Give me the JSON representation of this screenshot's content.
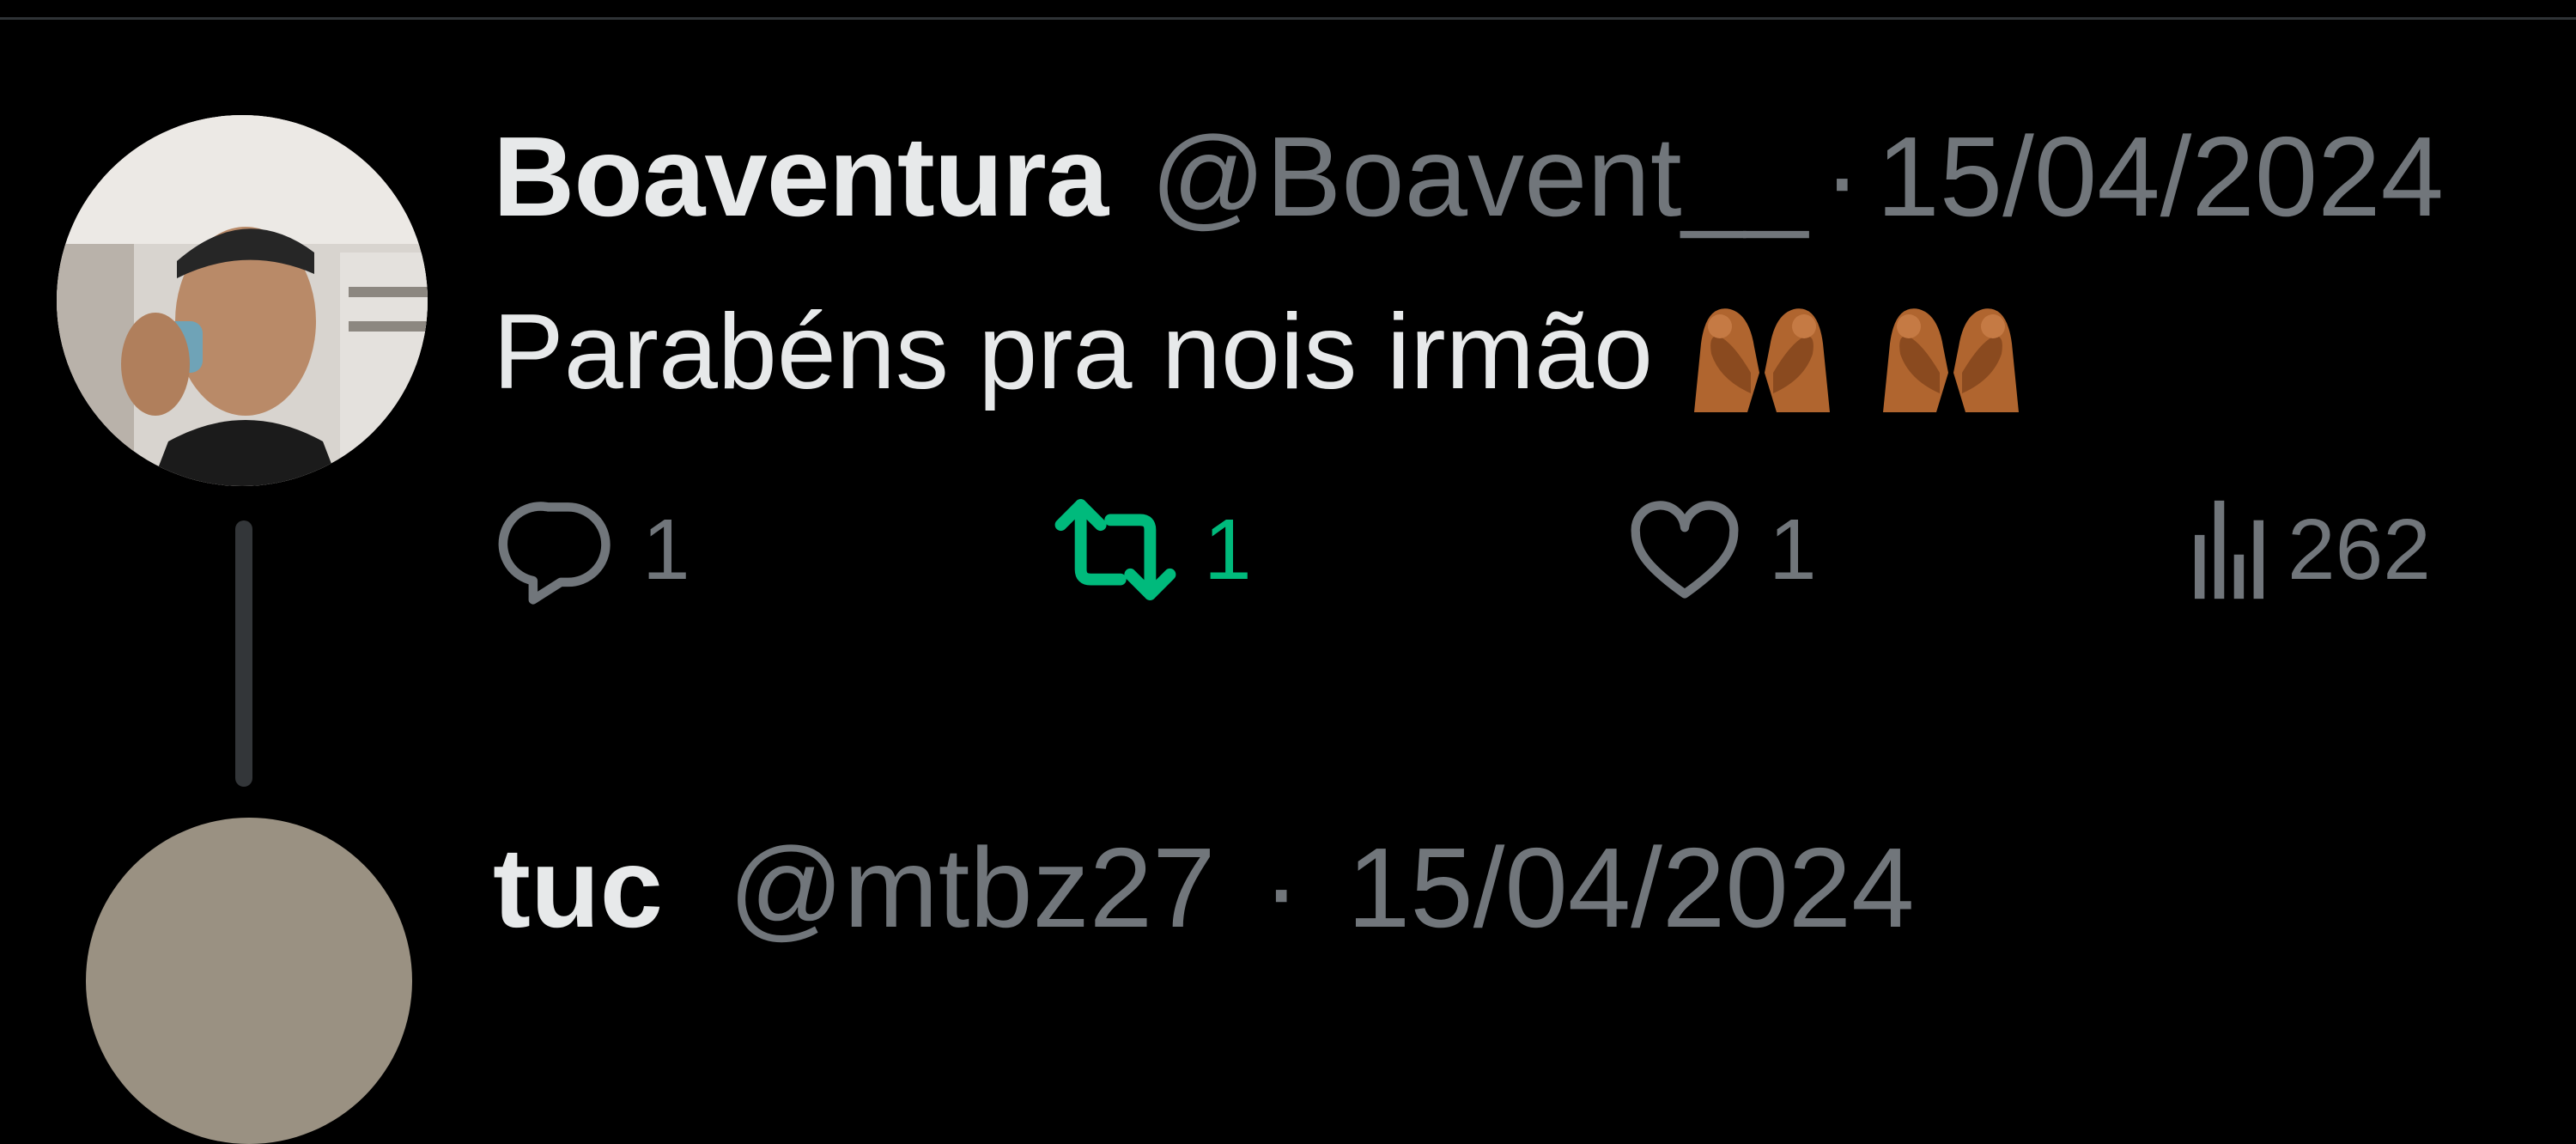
{
  "tweet": {
    "display_name": "Boaventura",
    "handle": "@Boavent__",
    "separator": "·",
    "date": "15/04/2024",
    "text": "Parabéns pra nois irmão",
    "emoji": "🫶🏾🫶🏾",
    "actions": {
      "reply_count": "1",
      "retweet_count": "1",
      "like_count": "1",
      "views_count": "262"
    }
  },
  "next_tweet": {
    "display_name": "tuc",
    "handle": "@mtbz27",
    "separator": "·",
    "date": "15/04/2024"
  },
  "colors": {
    "background": "#000000",
    "primary_text": "#e7e9ea",
    "secondary_text": "#71767b",
    "retweet_active": "#00ba7c",
    "divider": "#2f3336"
  },
  "icons": {
    "reply": "reply-icon",
    "retweet": "retweet-icon",
    "like": "heart-icon",
    "views": "views-icon"
  }
}
